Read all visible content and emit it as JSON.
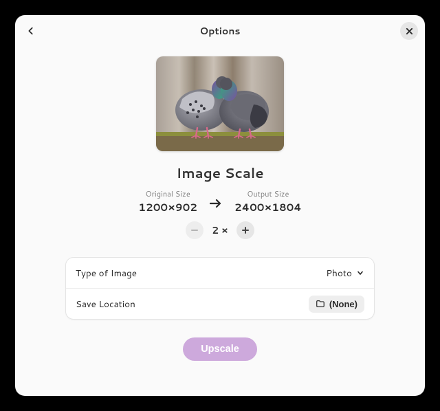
{
  "header": {
    "title": "Options"
  },
  "section": {
    "title": "Image Scale"
  },
  "sizes": {
    "original_label": "Original Size",
    "original_value": "1200×902",
    "output_label": "Output Size",
    "output_value": "2400×1804"
  },
  "scale": {
    "value_label": "2 ×"
  },
  "settings": {
    "type_label": "Type of Image",
    "type_value": "Photo",
    "location_label": "Save Location",
    "location_value": "(None)"
  },
  "actions": {
    "upscale_label": "Upscale"
  }
}
